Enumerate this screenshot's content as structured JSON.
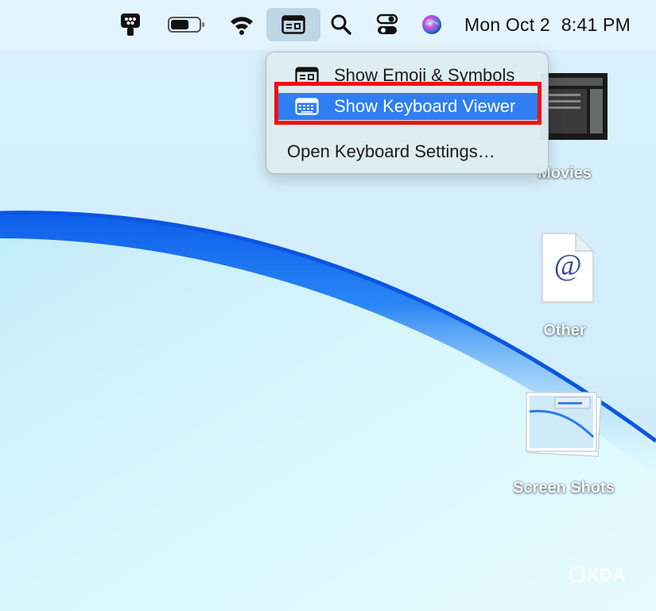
{
  "menubar": {
    "date": "Mon Oct 2",
    "time": "8:41 PM",
    "icons": [
      "tool-icon",
      "battery-icon",
      "wifi-icon",
      "keyboard-input-icon",
      "search-icon",
      "control-center-icon",
      "siri-icon"
    ]
  },
  "input_menu": {
    "items": [
      {
        "label": "Show Emoji & Symbols",
        "icon": "emoji-symbols-icon",
        "selected": false
      },
      {
        "label": "Show Keyboard Viewer",
        "icon": "keyboard-viewer-icon",
        "selected": true
      },
      {
        "label": "Open Keyboard Settings…",
        "selected": false
      }
    ]
  },
  "desktop": {
    "items": [
      {
        "label": "Movies",
        "icon": "movies-folder-icon"
      },
      {
        "label": "Other",
        "icon": "email-file-icon"
      },
      {
        "label": "Screen Shots",
        "icon": "screenshots-stack-icon"
      }
    ]
  },
  "watermark": {
    "text": "XDA"
  },
  "colors": {
    "selection": "#2f7ff2",
    "annotation": "#f20f0f",
    "wallpaper_light": "#d2eefb",
    "wallpaper_blue": "#1b6ef0"
  }
}
